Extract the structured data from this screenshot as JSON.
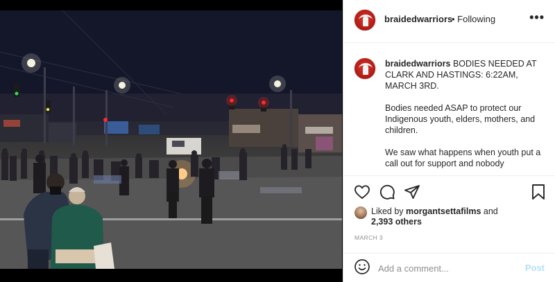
{
  "header": {
    "username": "braidedwarriors",
    "follow_label": "• Following",
    "more_label": "•••"
  },
  "caption": {
    "username": "braidedwarriors",
    "line1": "BODIES NEEDED AT CLARK AND HASTINGS: 6:22AM, MARCH 3RD.",
    "paragraph2": "Bodies needed ASAP to protect our Indigenous youth, elders, mothers, and children.",
    "paragraph3": "We saw what happens when youth put a call out for support and nobody"
  },
  "actions": {
    "heart_icon": "heart-outline-icon",
    "comment_icon": "comment-bubble-icon",
    "share_icon": "paper-plane-icon",
    "save_icon": "bookmark-icon"
  },
  "likes": {
    "prefix": "Liked by",
    "liker": "morgantsettafilms",
    "and": "and",
    "count": "2,393 others"
  },
  "date": "MARCH 3",
  "comment": {
    "emoji_icon": "emoji-smiley-icon",
    "placeholder": "Add a comment...",
    "post_label": "Post",
    "post_color": "#b2dffc"
  },
  "colors": {
    "text": "#262626",
    "muted": "#8e8e8e",
    "border": "#efefef",
    "brand_red": "#b51d17"
  }
}
